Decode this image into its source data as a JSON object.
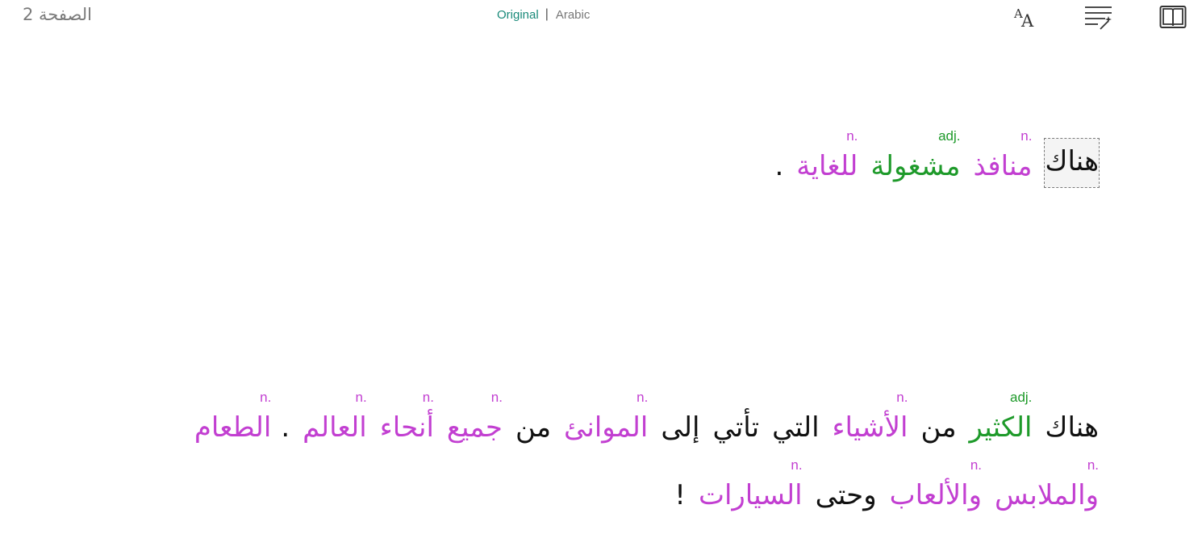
{
  "header": {
    "page_label": "الصفحة 2",
    "lang_original": "Original",
    "lang_separator": "|",
    "lang_translation": "Arabic"
  },
  "icons": {
    "font_size": "font-size-icon",
    "magic_format": "magic-format-icon",
    "book": "book-icon"
  },
  "colors": {
    "noun": "#c23fd1",
    "adjective": "#1e9a2a",
    "active_language": "#1a8a7a"
  },
  "paragraph1": {
    "line1": [
      {
        "word": "هناك",
        "tag": "",
        "type": "plain",
        "selected": true
      },
      {
        "word": "منافذ",
        "tag": "n.",
        "type": "noun"
      },
      {
        "word": "مشغولة",
        "tag": "adj.",
        "type": "adj"
      },
      {
        "word": "للغاية",
        "tag": "n.",
        "type": "noun"
      },
      {
        "word": ".",
        "tag": "",
        "type": "punct"
      }
    ]
  },
  "paragraph2": {
    "line1": [
      {
        "word": "هناك",
        "tag": "",
        "type": "plain"
      },
      {
        "word": "الكثير",
        "tag": "adj.",
        "type": "adj"
      },
      {
        "word": "من",
        "tag": "",
        "type": "plain"
      },
      {
        "word": "الأشياء",
        "tag": "n.",
        "type": "noun"
      },
      {
        "word": "التي",
        "tag": "",
        "type": "plain"
      },
      {
        "word": "تأتي",
        "tag": "",
        "type": "plain"
      },
      {
        "word": "إلى",
        "tag": "",
        "type": "plain"
      },
      {
        "word": "الموانئ",
        "tag": "n.",
        "type": "noun"
      },
      {
        "word": "من",
        "tag": "",
        "type": "plain"
      },
      {
        "word": "جميع",
        "tag": "n.",
        "type": "noun"
      },
      {
        "word": "أنحاء",
        "tag": "n.",
        "type": "noun"
      },
      {
        "word": "العالم",
        "tag": "n.",
        "type": "noun"
      },
      {
        "word": ".",
        "tag": "",
        "type": "punct"
      },
      {
        "word": "الطعام",
        "tag": "n.",
        "type": "noun"
      }
    ],
    "line2": [
      {
        "word": "والملابس",
        "tag": "n.",
        "type": "noun"
      },
      {
        "word": "والألعاب",
        "tag": "n.",
        "type": "noun"
      },
      {
        "word": "وحتى",
        "tag": "",
        "type": "plain"
      },
      {
        "word": "السيارات",
        "tag": "n.",
        "type": "noun"
      },
      {
        "word": "!",
        "tag": "",
        "type": "punct"
      }
    ]
  }
}
